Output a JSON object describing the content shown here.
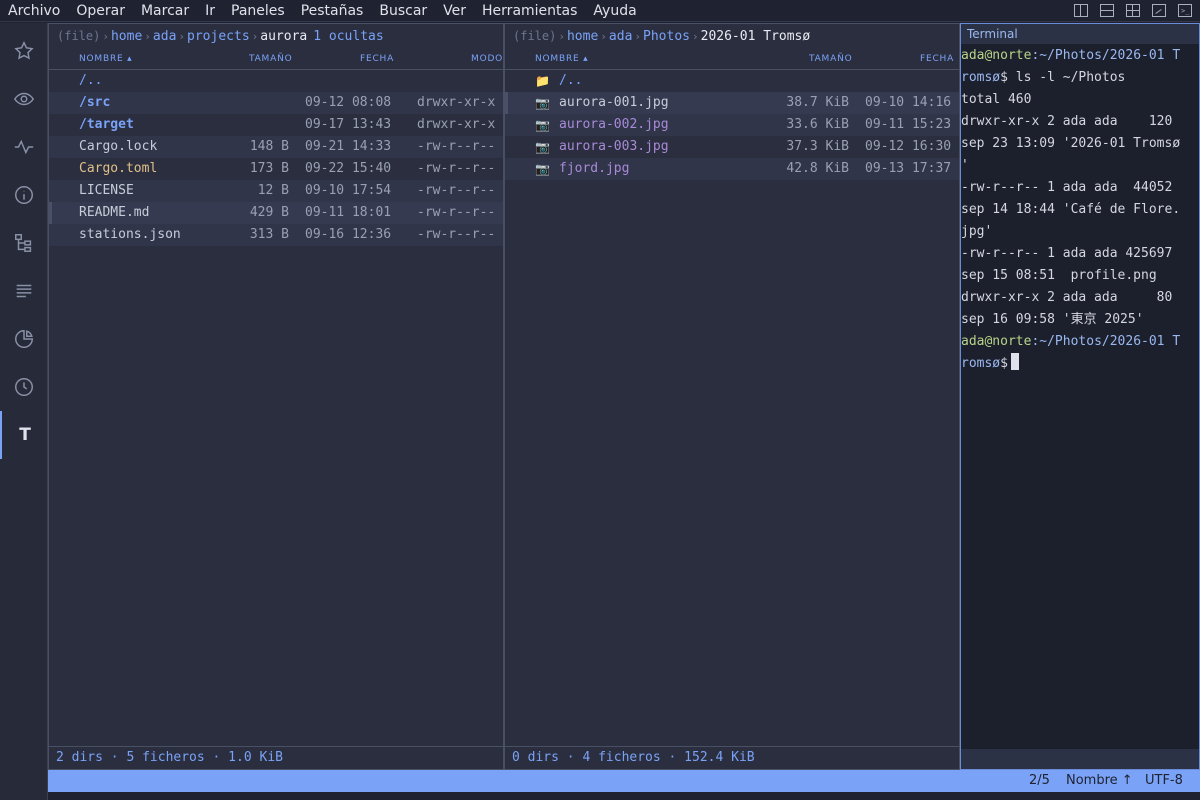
{
  "menubar": {
    "items": [
      "Archivo",
      "Operar",
      "Marcar",
      "Ir",
      "Paneles",
      "Pestañas",
      "Buscar",
      "Ver",
      "Herramientas",
      "Ayuda"
    ]
  },
  "activity_bar": {
    "items": [
      "star-icon",
      "eye-icon",
      "activity-icon",
      "info-icon",
      "tree-icon",
      "list-icon",
      "pie-chart-icon",
      "clock-icon",
      "terminal-t-icon"
    ],
    "active_glyph": "T"
  },
  "columns": {
    "name": "NOMBRE ▴",
    "size": "TAMAÑO",
    "date": "FECHA",
    "mode": "MODO"
  },
  "left_panel": {
    "proto": "(file)",
    "crumbs": [
      "home",
      "ada",
      "projects"
    ],
    "current": "aurora",
    "hidden": "1 ocultas",
    "rows": [
      {
        "name": "/..",
        "size": "",
        "date": "",
        "mode": ""
      },
      {
        "name": "/src",
        "size": "",
        "date": "09-12 08:08",
        "mode": "drwxr-xr-x"
      },
      {
        "name": "/target",
        "size": "",
        "date": "09-17 13:43",
        "mode": "drwxr-xr-x"
      },
      {
        "name": "Cargo.lock",
        "size": "148 B",
        "date": "09-21 14:33",
        "mode": "-rw-r--r--"
      },
      {
        "name": "Cargo.toml",
        "size": "173 B",
        "date": "09-22 15:40",
        "mode": "-rw-r--r--"
      },
      {
        "name": "LICENSE",
        "size": "12 B",
        "date": "09-10 17:54",
        "mode": "-rw-r--r--"
      },
      {
        "name": "README.md",
        "size": "429 B",
        "date": "09-11 18:01",
        "mode": "-rw-r--r--"
      },
      {
        "name": "stations.json",
        "size": "313 B",
        "date": "09-16 12:36",
        "mode": "-rw-r--r--"
      }
    ],
    "status": "2 dirs · 5 ficheros · 1.0 KiB"
  },
  "right_panel": {
    "proto": "(file)",
    "crumbs": [
      "home",
      "ada",
      "Photos"
    ],
    "current": "2026-01 Tromsø",
    "rows": [
      {
        "icon": "📁",
        "name": "/..",
        "size": "",
        "date": ""
      },
      {
        "icon": "📷",
        "name": "aurora-001.jpg",
        "size": "38.7 KiB",
        "date": "09-10 14:16"
      },
      {
        "icon": "📷",
        "name": "aurora-002.jpg",
        "size": "33.6 KiB",
        "date": "09-11 15:23"
      },
      {
        "icon": "📷",
        "name": "aurora-003.jpg",
        "size": "37.3 KiB",
        "date": "09-12 16:30"
      },
      {
        "icon": "📷",
        "name": "fjord.jpg",
        "size": "42.8 KiB",
        "date": "09-13 17:37"
      }
    ],
    "status": "0 dirs · 4 ficheros · 152.4 KiB"
  },
  "terminal": {
    "title": "Terminal",
    "prompt_user": "ada@norte",
    "prompt_path_line1": ":~/Photos/2026-01 T",
    "prompt_path_line2": "romsø",
    "command": "$ ls -l ~/Photos",
    "output": [
      "total 460",
      "drwxr-xr-x 2 ada ada    120",
      "sep 23 13:09 '2026-01 Tromsø",
      "'",
      "-rw-r--r-- 1 ada ada  44052",
      "sep 14 18:44 'Café de Flore.",
      "jpg'",
      "-rw-r--r-- 1 ada ada 425697",
      "sep 15 08:51  profile.png",
      "drwxr-xr-x 2 ada ada     80",
      "sep 16 09:58 '東京 2025'"
    ],
    "prompt_end": "$"
  },
  "statusbar": {
    "position": "2/5",
    "sort": "Nombre ↑",
    "encoding": "UTF-8"
  },
  "colors": {
    "accent": "#7aa2f7",
    "panel_bg": "#2a2e3e",
    "terminal_bg": "#1c1f2c",
    "image_file": "#a88ad8",
    "config_file": "#e0c08a",
    "prompt_user": "#b8d48a"
  }
}
